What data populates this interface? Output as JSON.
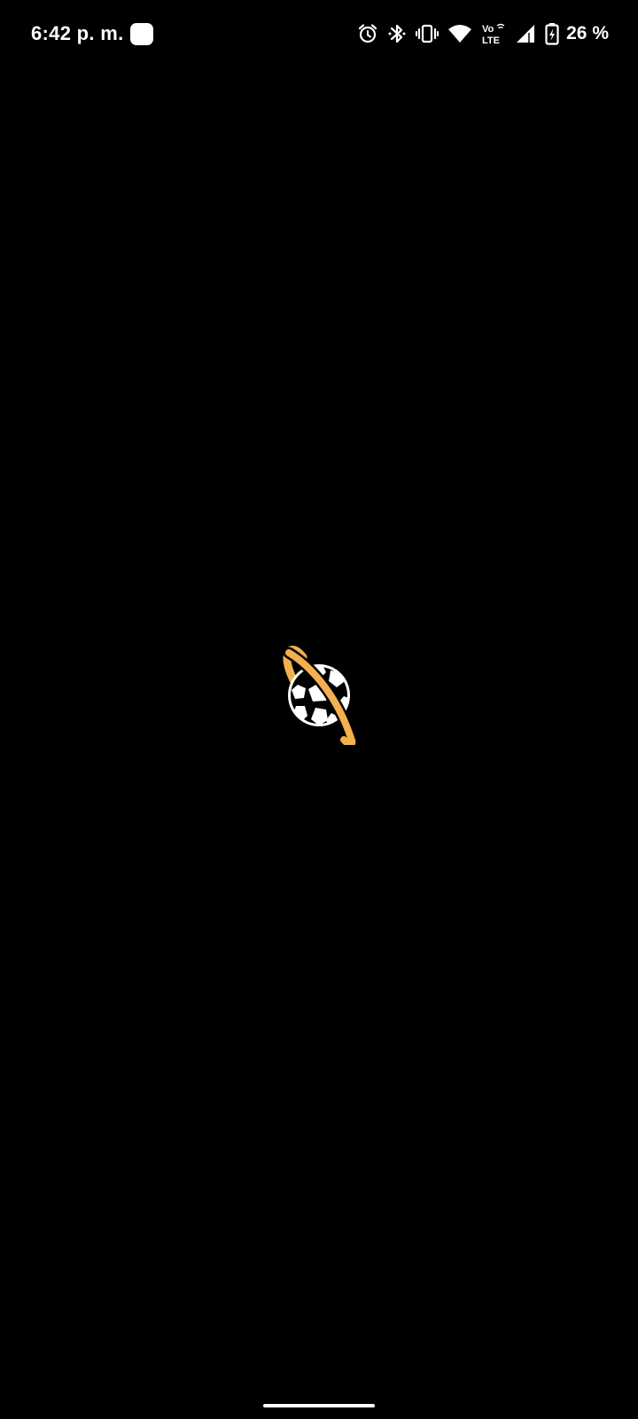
{
  "status_bar": {
    "time": "6:42 p. m.",
    "network_badge_top": "Vo",
    "network_badge_bottom": "LTE",
    "battery_percent": "26 %",
    "icons": [
      "app-notification-icon",
      "alarm-icon",
      "bluetooth-icon",
      "vibrate-icon",
      "wifi-icon",
      "volte-icon",
      "cell-signal-icon",
      "battery-charging-icon"
    ]
  },
  "splash": {
    "logo": "soccer-ball-planet-logo",
    "ring_color": "#F2B04E",
    "ball_color": "#FFFFFF",
    "background_color": "#000000"
  },
  "navigation": {
    "home_indicator": "gesture-bar"
  }
}
